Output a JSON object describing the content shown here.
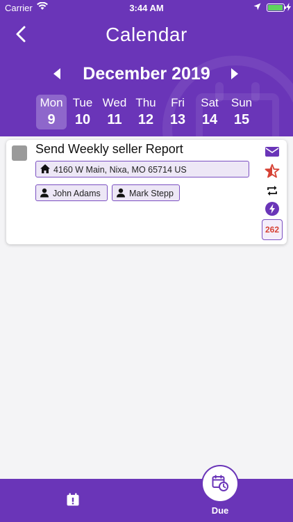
{
  "status_bar": {
    "carrier": "Carrier",
    "time": "3:44 AM"
  },
  "header": {
    "title": "Calendar",
    "month": "December 2019"
  },
  "week": [
    {
      "day": "Mon",
      "date": "9",
      "selected": true
    },
    {
      "day": "Tue",
      "date": "10"
    },
    {
      "day": "Wed",
      "date": "11"
    },
    {
      "day": "Thu",
      "date": "12"
    },
    {
      "day": "Fri",
      "date": "13"
    },
    {
      "day": "Sat",
      "date": "14"
    },
    {
      "day": "Sun",
      "date": "15"
    }
  ],
  "task": {
    "title": "Send Weekly seller Report",
    "address": "4160 W Main, Nixa, MO 65714 US",
    "assignees": [
      "John Adams",
      "Mark Stepp"
    ],
    "badge": "262",
    "actions": [
      "mail-icon",
      "star-icon",
      "repeat-icon",
      "flash-icon",
      "calendar-badge-icon"
    ]
  },
  "tab_bar": {
    "due_label": "Due"
  },
  "colors": {
    "primary": "#6a35b8",
    "selected_day": "#8e67cb",
    "chip_bg": "#ede7f6",
    "accent_red": "#d64235"
  }
}
